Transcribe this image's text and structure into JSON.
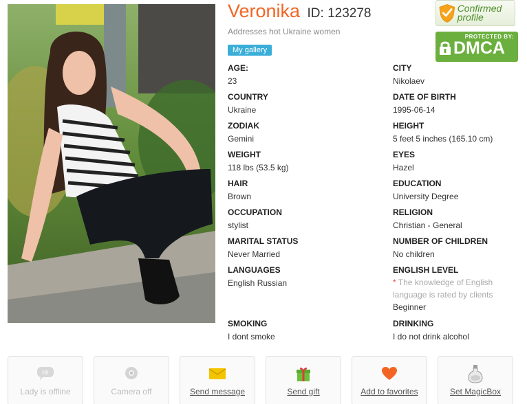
{
  "profile": {
    "name": "Veronika",
    "id_text": "ID: 123278",
    "tagline": "Addresses hot Ukraine women",
    "gallery_button": "My gallery"
  },
  "badges": {
    "confirmed": "Confirmed profile",
    "dmca_top": "PROTECTED BY:",
    "dmca_main": "DMCA"
  },
  "fields": {
    "age": {
      "label": "AGE:",
      "value": "23"
    },
    "city": {
      "label": "CITY",
      "value": "Nikolaev"
    },
    "country": {
      "label": "COUNTRY",
      "value": "Ukraine"
    },
    "dob": {
      "label": "DATE OF BIRTH",
      "value": "1995-06-14"
    },
    "zodiak": {
      "label": "ZODIAK",
      "value": "Gemini"
    },
    "height": {
      "label": "HEIGHT",
      "value": "5 feet 5 inches (165.10 cm)"
    },
    "weight": {
      "label": "WEIGHT",
      "value": "118 lbs (53.5 kg)"
    },
    "eyes": {
      "label": "EYES",
      "value": "Hazel"
    },
    "hair": {
      "label": "HAIR",
      "value": "Brown"
    },
    "education": {
      "label": "EDUCATION",
      "value": "University Degree"
    },
    "occupation": {
      "label": "OCCUPATION",
      "value": "stylist"
    },
    "religion": {
      "label": "RELIGION",
      "value": "Christian - General"
    },
    "marital": {
      "label": "MARITAL STATUS",
      "value": "Never Married"
    },
    "children": {
      "label": "NUMBER OF CHILDREN",
      "value": "No children"
    },
    "languages": {
      "label": "LANGUAGES",
      "value": "English Russian"
    },
    "english": {
      "label": "ENGLISH LEVEL",
      "note_star": "*",
      "note": "The knowledge of English language is rated by clients",
      "value": "Beginner"
    },
    "smoking": {
      "label": "SMOKING",
      "value": "I dont smoke"
    },
    "drinking": {
      "label": "DRINKING",
      "value": "I do not drink alcohol"
    }
  },
  "actions": [
    {
      "label": "Lady is offline",
      "icon": "chat-bubble-icon",
      "state": "disabled"
    },
    {
      "label": "Camera off",
      "icon": "webcam-icon",
      "state": "disabled"
    },
    {
      "label": "Send message",
      "icon": "envelope-icon",
      "state": "active"
    },
    {
      "label": "Send gift",
      "icon": "gift-icon",
      "state": "active"
    },
    {
      "label": "Add to favorites",
      "icon": "heart-icon",
      "state": "active"
    },
    {
      "label": "Set MagicBox",
      "icon": "potion-bottle-icon",
      "state": "active"
    }
  ],
  "colors": {
    "name": "#f26522",
    "gallery": "#3aaed8",
    "dmca": "#6bb03f",
    "confirmed_text": "#4e8e2b",
    "heart": "#f26522",
    "envelope": "#f5c400",
    "gift": "#6abf3b"
  }
}
